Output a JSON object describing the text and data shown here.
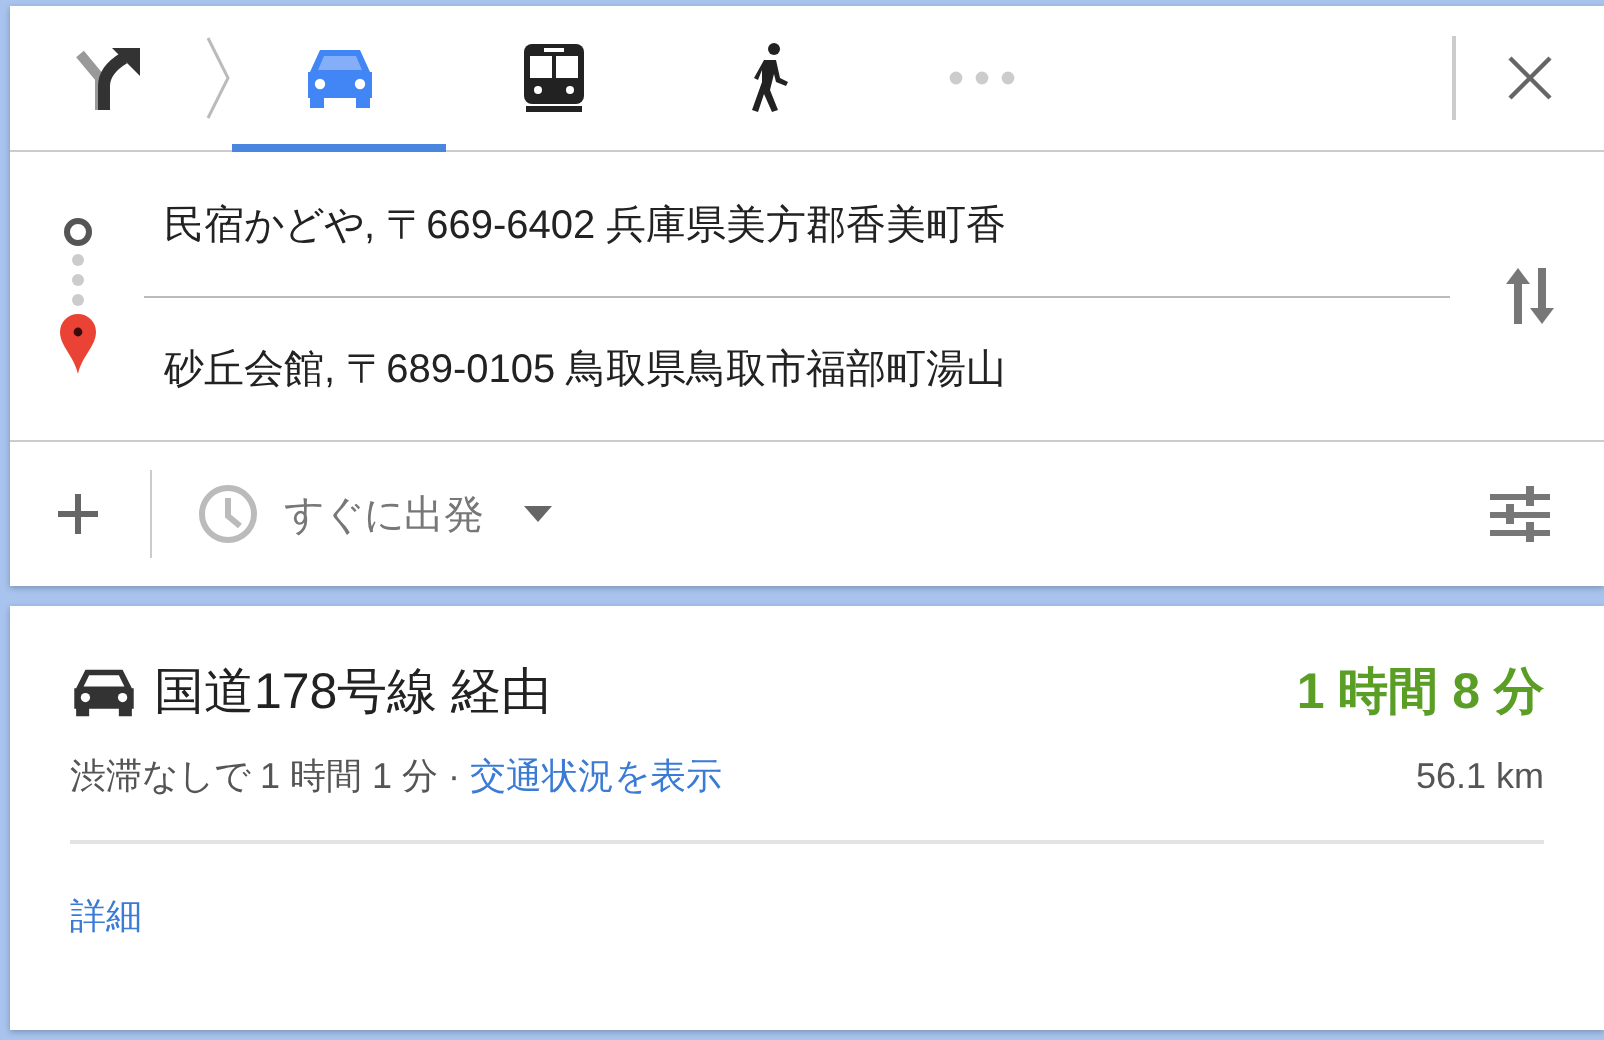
{
  "modes": [
    {
      "kind": "car",
      "selected": true
    },
    {
      "kind": "train",
      "selected": false
    },
    {
      "kind": "walk",
      "selected": false
    },
    {
      "kind": "more",
      "selected": false
    }
  ],
  "origin": {
    "value": "民宿かどや, 〒669-6402 兵庫県美方郡香美町香"
  },
  "destination": {
    "value": "砂丘会館, 〒689-0105 鳥取県鳥取市福部町湯山"
  },
  "depart": {
    "label": "すぐに出発"
  },
  "route": {
    "title": "国道178号線 経由",
    "duration": "1 時間 8 分",
    "summary": "渋滞なしで 1 時間 1 分 ·",
    "traffic_link": "交通状況を表示",
    "distance": "56.1 km",
    "details_link": "詳細"
  }
}
